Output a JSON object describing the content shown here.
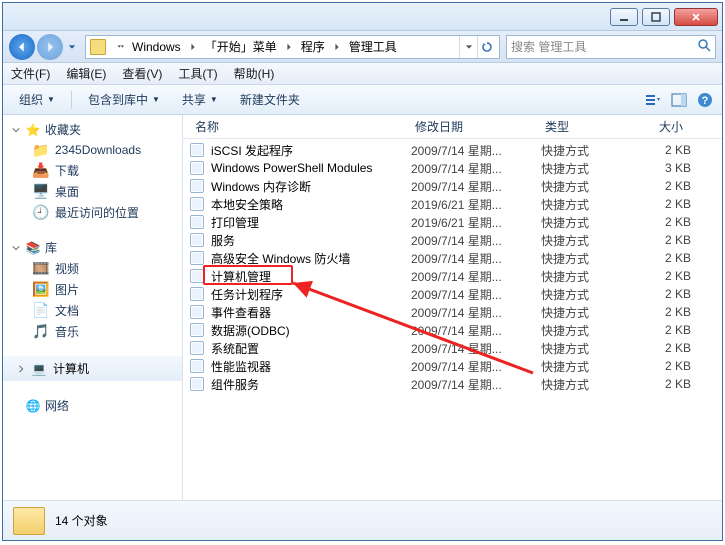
{
  "breadcrumb": {
    "parts": [
      "Windows",
      "「开始」菜单",
      "程序",
      "管理工具"
    ]
  },
  "search": {
    "placeholder": "搜索 管理工具"
  },
  "menu": {
    "file": "文件(F)",
    "edit": "编辑(E)",
    "view": "查看(V)",
    "tools": "工具(T)",
    "help": "帮助(H)"
  },
  "toolbar": {
    "organize": "组织",
    "include": "包含到库中",
    "share": "共享",
    "newfolder": "新建文件夹"
  },
  "columns": {
    "name": "名称",
    "date": "修改日期",
    "type": "类型",
    "size": "大小"
  },
  "sidebar": {
    "fav": {
      "label": "收藏夹",
      "items": [
        "2345Downloads",
        "下载",
        "桌面",
        "最近访问的位置"
      ]
    },
    "lib": {
      "label": "库",
      "items": [
        "视频",
        "图片",
        "文档",
        "音乐"
      ]
    },
    "computer": {
      "label": "计算机"
    },
    "network": {
      "label": "网络"
    }
  },
  "items": [
    {
      "name": "iSCSI 发起程序",
      "date": "2009/7/14 星期...",
      "type": "快捷方式",
      "size": "2 KB"
    },
    {
      "name": "Windows PowerShell Modules",
      "date": "2009/7/14 星期...",
      "type": "快捷方式",
      "size": "3 KB"
    },
    {
      "name": "Windows 内存诊断",
      "date": "2009/7/14 星期...",
      "type": "快捷方式",
      "size": "2 KB"
    },
    {
      "name": "本地安全策略",
      "date": "2019/6/21 星期...",
      "type": "快捷方式",
      "size": "2 KB"
    },
    {
      "name": "打印管理",
      "date": "2019/6/21 星期...",
      "type": "快捷方式",
      "size": "2 KB"
    },
    {
      "name": "服务",
      "date": "2009/7/14 星期...",
      "type": "快捷方式",
      "size": "2 KB"
    },
    {
      "name": "高级安全 Windows 防火墙",
      "date": "2009/7/14 星期...",
      "type": "快捷方式",
      "size": "2 KB"
    },
    {
      "name": "计算机管理",
      "date": "2009/7/14 星期...",
      "type": "快捷方式",
      "size": "2 KB"
    },
    {
      "name": "任务计划程序",
      "date": "2009/7/14 星期...",
      "type": "快捷方式",
      "size": "2 KB"
    },
    {
      "name": "事件查看器",
      "date": "2009/7/14 星期...",
      "type": "快捷方式",
      "size": "2 KB"
    },
    {
      "name": "数据源(ODBC)",
      "date": "2009/7/14 星期...",
      "type": "快捷方式",
      "size": "2 KB"
    },
    {
      "name": "系统配置",
      "date": "2009/7/14 星期...",
      "type": "快捷方式",
      "size": "2 KB"
    },
    {
      "name": "性能监视器",
      "date": "2009/7/14 星期...",
      "type": "快捷方式",
      "size": "2 KB"
    },
    {
      "name": "组件服务",
      "date": "2009/7/14 星期...",
      "type": "快捷方式",
      "size": "2 KB"
    }
  ],
  "status": {
    "count": "14 个对象"
  },
  "highlight_index": 7
}
